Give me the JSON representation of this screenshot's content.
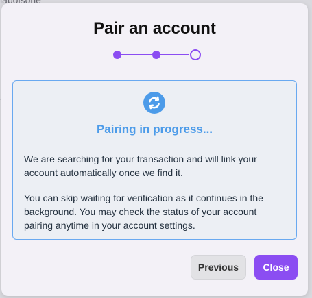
{
  "background": {
    "partial_text": "labolsone"
  },
  "modal": {
    "title": "Pair an account",
    "stepper": {
      "total_steps": 3,
      "current_step": 3,
      "accent_color": "#8b4df2"
    },
    "info_panel": {
      "icon": "sync-icon",
      "status_title": "Pairing in progress...",
      "status_color": "#4c9be9",
      "paragraph_1": "We are searching for your transaction and will link your account automatically once we find it.",
      "paragraph_2": "You can skip waiting for verification as it continues in the background. You may check the status of your account pairing anytime in your account settings."
    },
    "buttons": {
      "previous_label": "Previous",
      "close_label": "Close"
    }
  }
}
